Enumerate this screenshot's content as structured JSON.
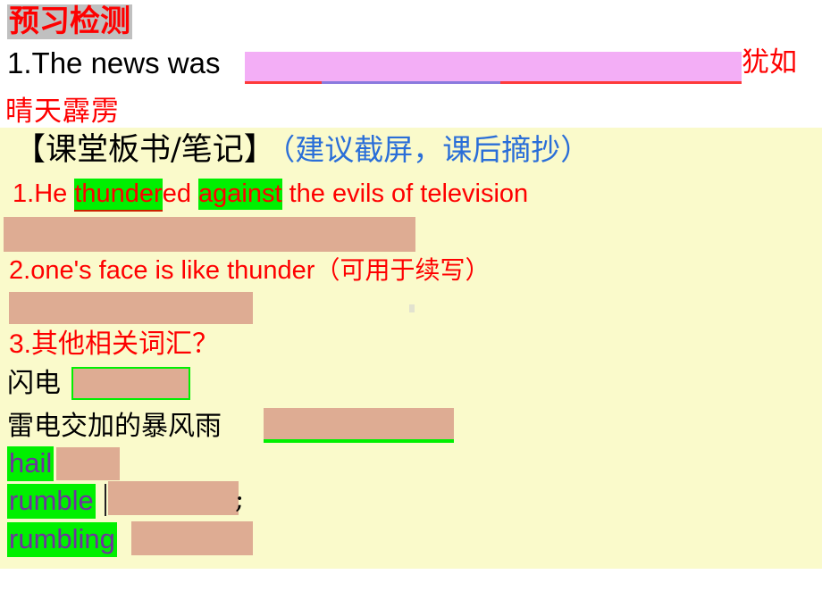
{
  "slide": {
    "background_color": "#ffffff",
    "board_color": "#fafacb",
    "cover_color": "#deac93",
    "highlight_green": "#00f000",
    "highlight_gray": "#c0c0c0",
    "blank_pink": "#f3aef6",
    "red": "#fe0000",
    "blue": "#2a6ed8",
    "purple": "#7030a0"
  },
  "header": {
    "title": "预习检测",
    "question_number": "1.",
    "question_text": "The news was",
    "blank_answer_hidden": "",
    "translation_part1": "犹如",
    "translation_part2": "晴天霹雳"
  },
  "notes": {
    "heading_black": "【课堂板书/笔记】",
    "heading_blue": "（建议截屏，课后摘抄）",
    "items": [
      {
        "number": "1.",
        "pre": "He ",
        "hl1": "thunder",
        "mid1": "ed ",
        "hl2": "against",
        "post": " the evils of television",
        "cover_hidden": ""
      },
      {
        "number": "2.",
        "text": "one's face is like thunder",
        "paren": "（可用于续写）",
        "cover_hidden": ""
      },
      {
        "number": "3.",
        "text": "其他相关词汇？"
      }
    ],
    "vocab": [
      {
        "label": "闪电",
        "label_color": "black",
        "answer_hidden": ""
      },
      {
        "label": "雷电交加的暴风雨",
        "label_color": "black",
        "answer_hidden": ""
      },
      {
        "label": "hail",
        "label_color": "purple",
        "answer_hidden": ""
      },
      {
        "label": "rumble",
        "label_color": "purple",
        "answer_hidden": "",
        "trailing": ";"
      },
      {
        "label": "rumbling",
        "label_color": "purple",
        "answer_hidden": ""
      }
    ]
  }
}
